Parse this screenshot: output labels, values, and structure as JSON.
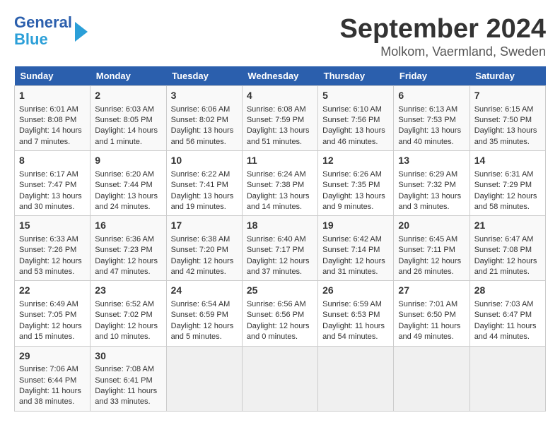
{
  "header": {
    "logo_line1": "General",
    "logo_line2": "Blue",
    "month": "September 2024",
    "location": "Molkom, Vaermland, Sweden"
  },
  "weekdays": [
    "Sunday",
    "Monday",
    "Tuesday",
    "Wednesday",
    "Thursday",
    "Friday",
    "Saturday"
  ],
  "weeks": [
    [
      {
        "day": "1",
        "lines": [
          "Sunrise: 6:01 AM",
          "Sunset: 8:08 PM",
          "Daylight: 14 hours",
          "and 7 minutes."
        ]
      },
      {
        "day": "2",
        "lines": [
          "Sunrise: 6:03 AM",
          "Sunset: 8:05 PM",
          "Daylight: 14 hours",
          "and 1 minute."
        ]
      },
      {
        "day": "3",
        "lines": [
          "Sunrise: 6:06 AM",
          "Sunset: 8:02 PM",
          "Daylight: 13 hours",
          "and 56 minutes."
        ]
      },
      {
        "day": "4",
        "lines": [
          "Sunrise: 6:08 AM",
          "Sunset: 7:59 PM",
          "Daylight: 13 hours",
          "and 51 minutes."
        ]
      },
      {
        "day": "5",
        "lines": [
          "Sunrise: 6:10 AM",
          "Sunset: 7:56 PM",
          "Daylight: 13 hours",
          "and 46 minutes."
        ]
      },
      {
        "day": "6",
        "lines": [
          "Sunrise: 6:13 AM",
          "Sunset: 7:53 PM",
          "Daylight: 13 hours",
          "and 40 minutes."
        ]
      },
      {
        "day": "7",
        "lines": [
          "Sunrise: 6:15 AM",
          "Sunset: 7:50 PM",
          "Daylight: 13 hours",
          "and 35 minutes."
        ]
      }
    ],
    [
      {
        "day": "8",
        "lines": [
          "Sunrise: 6:17 AM",
          "Sunset: 7:47 PM",
          "Daylight: 13 hours",
          "and 30 minutes."
        ]
      },
      {
        "day": "9",
        "lines": [
          "Sunrise: 6:20 AM",
          "Sunset: 7:44 PM",
          "Daylight: 13 hours",
          "and 24 minutes."
        ]
      },
      {
        "day": "10",
        "lines": [
          "Sunrise: 6:22 AM",
          "Sunset: 7:41 PM",
          "Daylight: 13 hours",
          "and 19 minutes."
        ]
      },
      {
        "day": "11",
        "lines": [
          "Sunrise: 6:24 AM",
          "Sunset: 7:38 PM",
          "Daylight: 13 hours",
          "and 14 minutes."
        ]
      },
      {
        "day": "12",
        "lines": [
          "Sunrise: 6:26 AM",
          "Sunset: 7:35 PM",
          "Daylight: 13 hours",
          "and 9 minutes."
        ]
      },
      {
        "day": "13",
        "lines": [
          "Sunrise: 6:29 AM",
          "Sunset: 7:32 PM",
          "Daylight: 13 hours",
          "and 3 minutes."
        ]
      },
      {
        "day": "14",
        "lines": [
          "Sunrise: 6:31 AM",
          "Sunset: 7:29 PM",
          "Daylight: 12 hours",
          "and 58 minutes."
        ]
      }
    ],
    [
      {
        "day": "15",
        "lines": [
          "Sunrise: 6:33 AM",
          "Sunset: 7:26 PM",
          "Daylight: 12 hours",
          "and 53 minutes."
        ]
      },
      {
        "day": "16",
        "lines": [
          "Sunrise: 6:36 AM",
          "Sunset: 7:23 PM",
          "Daylight: 12 hours",
          "and 47 minutes."
        ]
      },
      {
        "day": "17",
        "lines": [
          "Sunrise: 6:38 AM",
          "Sunset: 7:20 PM",
          "Daylight: 12 hours",
          "and 42 minutes."
        ]
      },
      {
        "day": "18",
        "lines": [
          "Sunrise: 6:40 AM",
          "Sunset: 7:17 PM",
          "Daylight: 12 hours",
          "and 37 minutes."
        ]
      },
      {
        "day": "19",
        "lines": [
          "Sunrise: 6:42 AM",
          "Sunset: 7:14 PM",
          "Daylight: 12 hours",
          "and 31 minutes."
        ]
      },
      {
        "day": "20",
        "lines": [
          "Sunrise: 6:45 AM",
          "Sunset: 7:11 PM",
          "Daylight: 12 hours",
          "and 26 minutes."
        ]
      },
      {
        "day": "21",
        "lines": [
          "Sunrise: 6:47 AM",
          "Sunset: 7:08 PM",
          "Daylight: 12 hours",
          "and 21 minutes."
        ]
      }
    ],
    [
      {
        "day": "22",
        "lines": [
          "Sunrise: 6:49 AM",
          "Sunset: 7:05 PM",
          "Daylight: 12 hours",
          "and 15 minutes."
        ]
      },
      {
        "day": "23",
        "lines": [
          "Sunrise: 6:52 AM",
          "Sunset: 7:02 PM",
          "Daylight: 12 hours",
          "and 10 minutes."
        ]
      },
      {
        "day": "24",
        "lines": [
          "Sunrise: 6:54 AM",
          "Sunset: 6:59 PM",
          "Daylight: 12 hours",
          "and 5 minutes."
        ]
      },
      {
        "day": "25",
        "lines": [
          "Sunrise: 6:56 AM",
          "Sunset: 6:56 PM",
          "Daylight: 12 hours",
          "and 0 minutes."
        ]
      },
      {
        "day": "26",
        "lines": [
          "Sunrise: 6:59 AM",
          "Sunset: 6:53 PM",
          "Daylight: 11 hours",
          "and 54 minutes."
        ]
      },
      {
        "day": "27",
        "lines": [
          "Sunrise: 7:01 AM",
          "Sunset: 6:50 PM",
          "Daylight: 11 hours",
          "and 49 minutes."
        ]
      },
      {
        "day": "28",
        "lines": [
          "Sunrise: 7:03 AM",
          "Sunset: 6:47 PM",
          "Daylight: 11 hours",
          "and 44 minutes."
        ]
      }
    ],
    [
      {
        "day": "29",
        "lines": [
          "Sunrise: 7:06 AM",
          "Sunset: 6:44 PM",
          "Daylight: 11 hours",
          "and 38 minutes."
        ]
      },
      {
        "day": "30",
        "lines": [
          "Sunrise: 7:08 AM",
          "Sunset: 6:41 PM",
          "Daylight: 11 hours",
          "and 33 minutes."
        ]
      },
      {
        "day": "",
        "lines": []
      },
      {
        "day": "",
        "lines": []
      },
      {
        "day": "",
        "lines": []
      },
      {
        "day": "",
        "lines": []
      },
      {
        "day": "",
        "lines": []
      }
    ]
  ]
}
